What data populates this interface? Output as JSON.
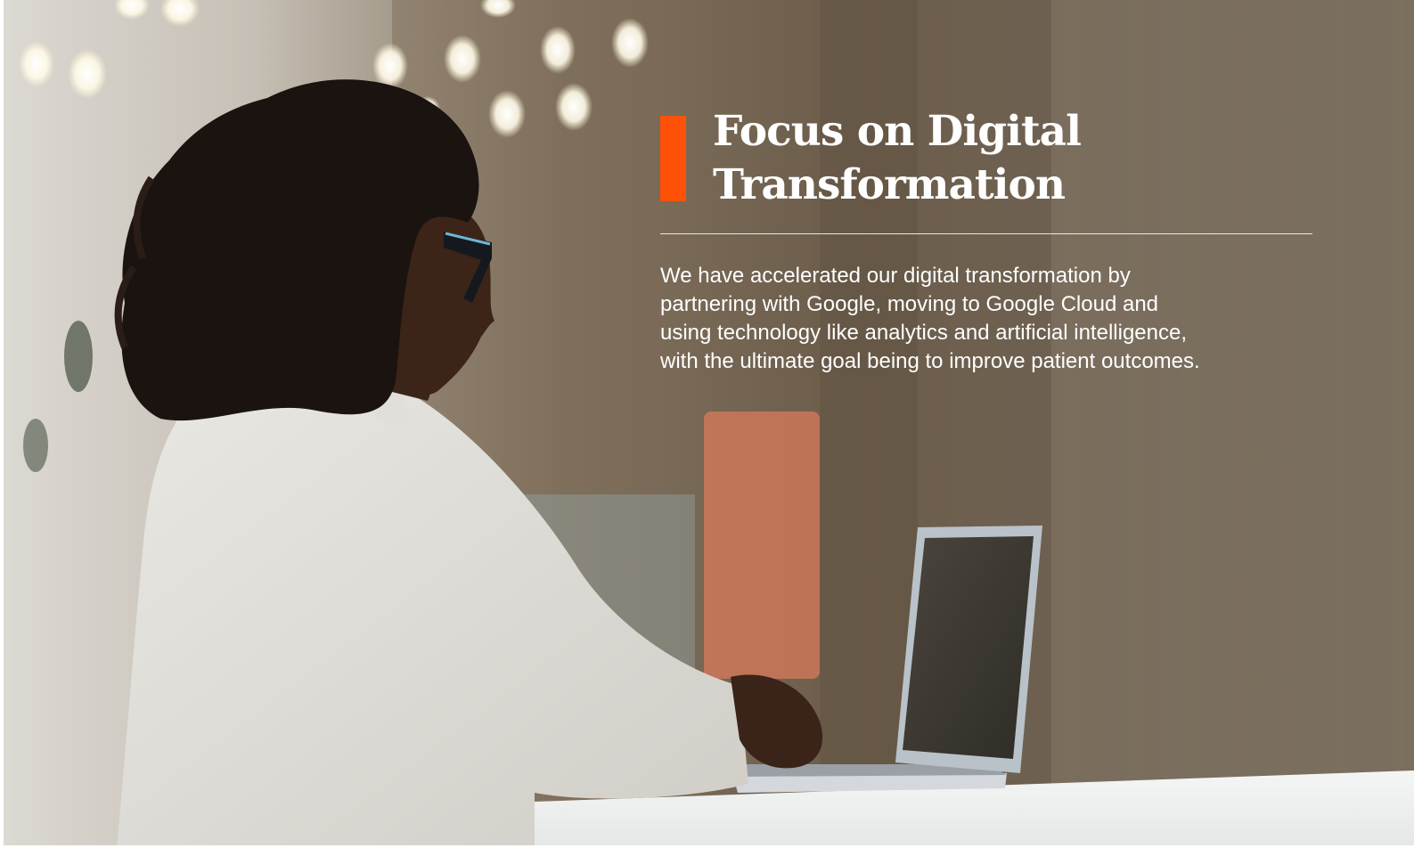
{
  "section": {
    "headline_line1": "Focus on Digital",
    "headline_line2": "Transformation",
    "body": "We have accelerated our digital transformation by\npartnering with Google, moving to Google Cloud and\nusing technology like analytics and artificial intelligence,\nwith the ultimate goal being to improve patient outcomes."
  },
  "colors": {
    "accent": "#fd5108",
    "text": "#ffffff"
  },
  "photo": {
    "subject": "person-at-laptop-photo"
  }
}
